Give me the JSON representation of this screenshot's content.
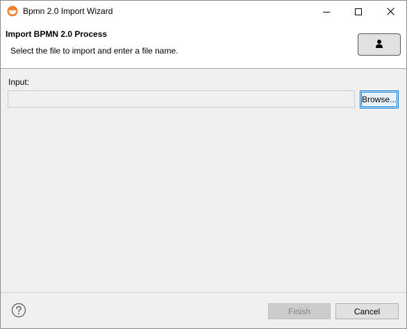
{
  "window": {
    "title": "Bpmn 2.0 Import Wizard",
    "app_icon": "eclipse-icon",
    "controls": {
      "minimize_icon": "minimize-icon",
      "maximize_icon": "maximize-icon",
      "close_icon": "close-icon"
    }
  },
  "banner": {
    "title": "Import BPMN 2.0 Process",
    "description": "Select the file to import and enter a file name.",
    "image_icon": "user-icon"
  },
  "form": {
    "input_label": "Input:",
    "input_value": "",
    "browse_label": "Browse..."
  },
  "footer": {
    "help_icon": "help-icon",
    "finish_label": "Finish",
    "finish_enabled": false,
    "cancel_label": "Cancel"
  },
  "colors": {
    "accent": "#0078d7",
    "eclipse_orange": "#f47a20",
    "disabled_text": "#838383"
  }
}
